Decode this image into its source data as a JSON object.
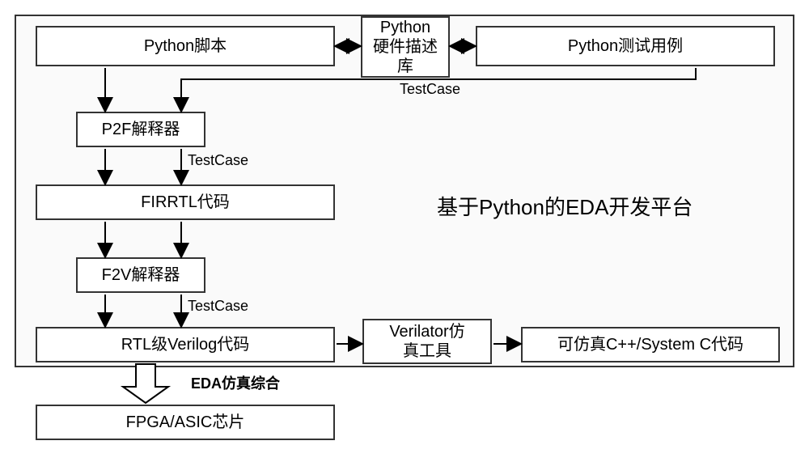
{
  "title_right": "基于Python的EDA开发平台",
  "boxes": {
    "python_script": "Python脚本",
    "hwdesc": "Python\n硬件描述\n库",
    "testcases": "Python测试用例",
    "p2f": "P2F解释器",
    "firrtl": "FIRRTL代码",
    "f2v": "F2V解释器",
    "rtl": "RTL级Verilog代码",
    "verilator": "Verilator仿\n真工具",
    "cpp": "可仿真C++/System C代码",
    "fpga": "FPGA/ASIC芯片"
  },
  "edge_labels": {
    "tc_top": "TestCase",
    "tc_mid": "TestCase",
    "tc_low": "TestCase",
    "eda": "EDA仿真综合"
  }
}
